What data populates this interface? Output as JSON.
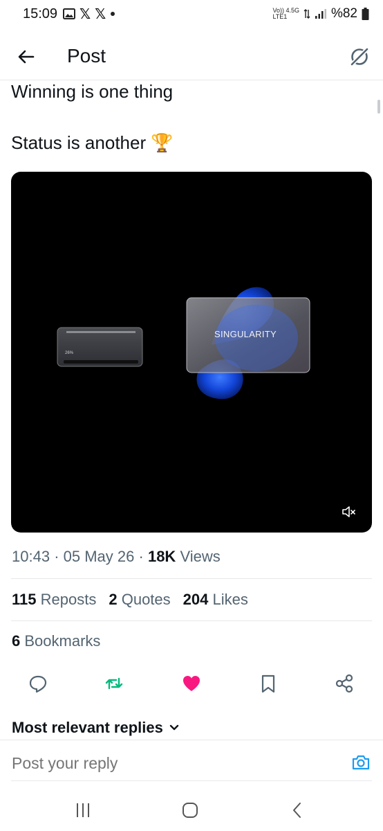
{
  "status_bar": {
    "time": "15:09",
    "net_top": "Vo)) 4.5G",
    "net_bottom": "LTE1",
    "battery": "%82",
    "notification_icons": [
      "image-icon",
      "x-logo-icon",
      "x-logo-icon",
      "dot-icon"
    ]
  },
  "header": {
    "title": "Post",
    "back_icon": "arrow-left-icon",
    "grok_icon": "grok-icon"
  },
  "post": {
    "line1": "Winning is one thing",
    "line2": "Status is another 🏆",
    "media": {
      "card_label": "SINGULARITY",
      "small_card_label": "26%",
      "mute_icon": "speaker-muted-icon"
    },
    "meta": {
      "time": "10:43",
      "date": "05 May 26",
      "views_count": "18K",
      "views_label": "Views",
      "separator": "·"
    },
    "stats": {
      "reposts_count": "115",
      "reposts_label": "Reposts",
      "quotes_count": "2",
      "quotes_label": "Quotes",
      "likes_count": "204",
      "likes_label": "Likes"
    },
    "bookmarks": {
      "count": "6",
      "label": "Bookmarks"
    }
  },
  "actions": {
    "reply_icon": "reply-icon",
    "repost_icon": "repost-icon",
    "like_icon": "heart-filled-icon",
    "bookmark_icon": "bookmark-icon",
    "share_icon": "share-icon"
  },
  "replies": {
    "heading": "Most relevant replies",
    "chevron_icon": "chevron-down-icon"
  },
  "reply_bar": {
    "placeholder": "Post your reply",
    "camera_icon": "camera-icon"
  },
  "nav": {
    "recents_icon": "recents-icon",
    "home_icon": "home-icon",
    "back_icon": "back-icon"
  },
  "colors": {
    "text": "#0f1419",
    "muted": "#536471",
    "repost_green": "#00ba7c",
    "like_pink": "#f91880",
    "camera_blue": "#1d9bf0"
  }
}
